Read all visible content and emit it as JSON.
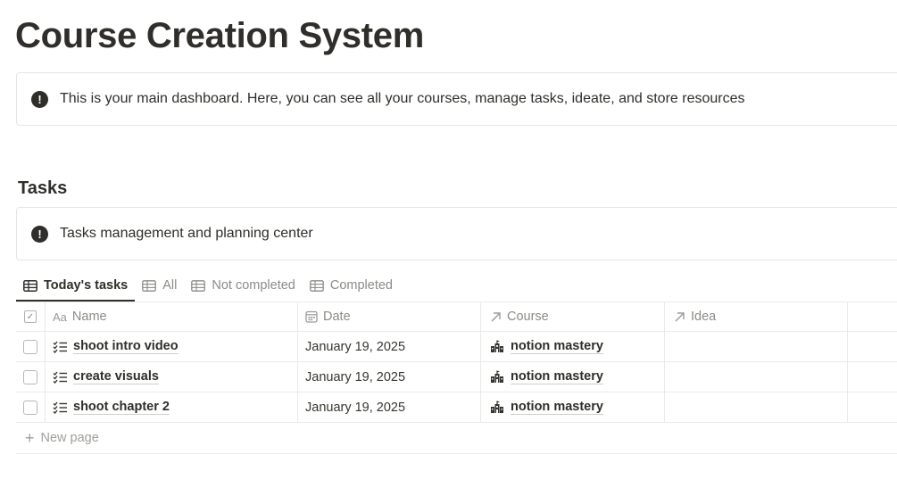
{
  "page": {
    "title": "Course Creation System"
  },
  "callouts": {
    "main": "This is your main dashboard. Here, you can see all your courses, manage tasks, ideate, and store resources",
    "tasks": "Tasks management and planning center"
  },
  "tasks_section": {
    "title": "Tasks"
  },
  "tabs": [
    {
      "label": "Today's tasks",
      "active": true
    },
    {
      "label": "All"
    },
    {
      "label": "Not completed"
    },
    {
      "label": "Completed"
    }
  ],
  "table": {
    "columns": {
      "name": "Name",
      "date": "Date",
      "course": "Course",
      "idea": "Idea"
    },
    "name_prefix": "Aa",
    "rows": [
      {
        "name": "shoot intro video",
        "date": "January 19, 2025",
        "course": "notion mastery",
        "idea": ""
      },
      {
        "name": "create visuals",
        "date": "January 19, 2025",
        "course": "notion mastery",
        "idea": ""
      },
      {
        "name": "shoot chapter 2",
        "date": "January 19, 2025",
        "course": "notion mastery",
        "idea": ""
      }
    ],
    "new_page_label": "New page"
  },
  "icons": {
    "callout": "exclamation-circle-icon",
    "tab": "table-icon",
    "task": "checklist-icon",
    "course": "school-icon",
    "relation": "arrow-up-right-icon",
    "date": "calendar-icon"
  }
}
